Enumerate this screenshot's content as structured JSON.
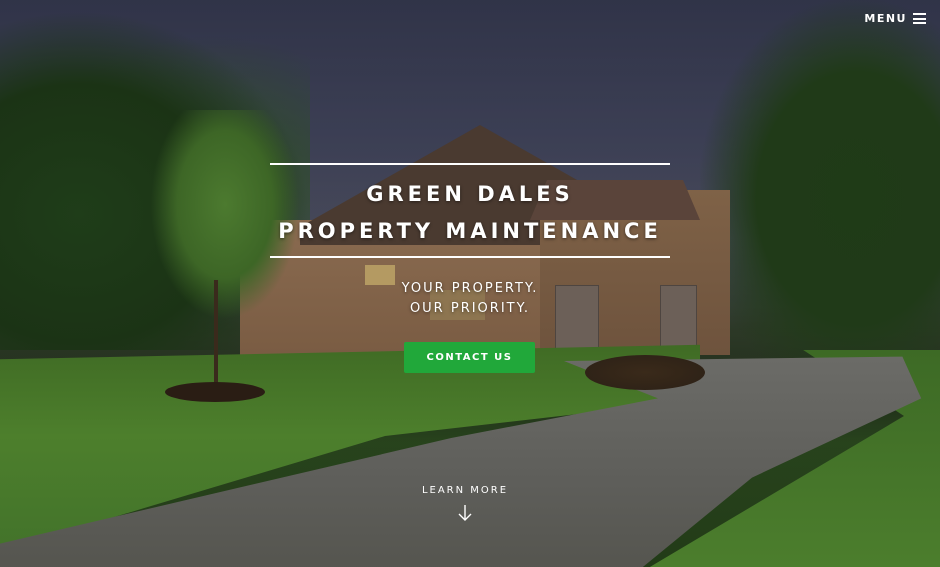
{
  "header": {
    "menu_label": "MENU",
    "menu_icon": "hamburger-icon"
  },
  "hero": {
    "title_line_1": "GREEN DALES",
    "title_line_2": "PROPERTY MAINTENANCE",
    "tagline_line_1": "YOUR PROPERTY.",
    "tagline_line_2": "OUR PRIORITY.",
    "cta_label": "CONTACT US",
    "learn_more_label": "LEARN MORE",
    "learn_more_icon": "arrow-down-icon"
  },
  "colors": {
    "accent": "#21a83a",
    "text": "#ffffff"
  }
}
